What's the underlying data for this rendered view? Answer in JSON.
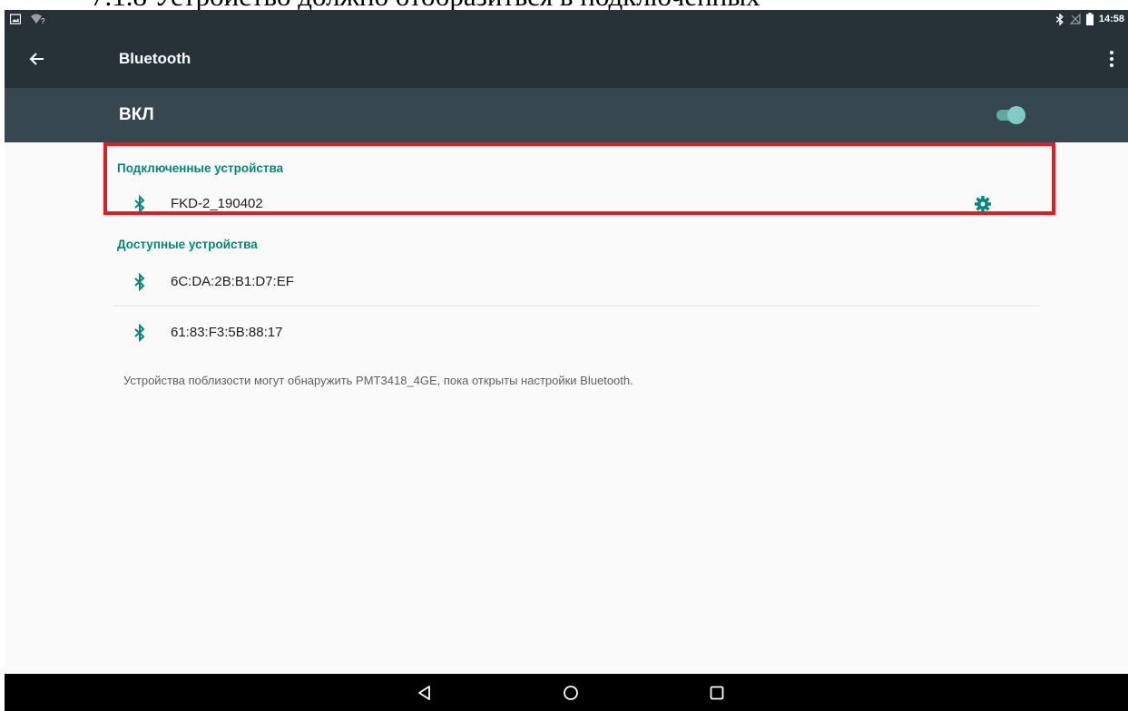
{
  "caption": "7.1.8 Устройство должно отобразиться в подключенных",
  "status_bar": {
    "left_icons": [
      "gallery-icon",
      "wifi-question-icon"
    ],
    "right_icons": [
      "bluetooth-icon",
      "no-sim-icon",
      "battery-icon"
    ],
    "time": "14:58"
  },
  "action_bar": {
    "title": "Bluetooth",
    "back_icon": "arrow-back-icon",
    "menu_icon": "more-vert-icon"
  },
  "switch_bar": {
    "label": "ВКЛ",
    "enabled": true
  },
  "connected": {
    "header": "Подключенные устройства",
    "devices": [
      {
        "name": "FKD-2_190402",
        "icon": "bluetooth-icon",
        "settings_icon": "gear-icon"
      }
    ]
  },
  "available": {
    "header": "Доступные устройства",
    "devices": [
      {
        "name": "6C:DA:2B:B1:D7:EF",
        "icon": "bluetooth-icon"
      },
      {
        "name": "61:83:F3:5B:88:17",
        "icon": "bluetooth-icon"
      }
    ]
  },
  "footer_note": "Устройства поблизости могут обнаружить PMT3418_4GE, пока открыты настройки Bluetooth.",
  "nav_bar": {
    "buttons": [
      "back-triangle-icon",
      "home-circle-icon",
      "recents-square-icon"
    ]
  },
  "colors": {
    "status_bar": "#263238",
    "switch_bar": "#37474f",
    "accent": "#00897b",
    "highlight": "#e31b23"
  }
}
